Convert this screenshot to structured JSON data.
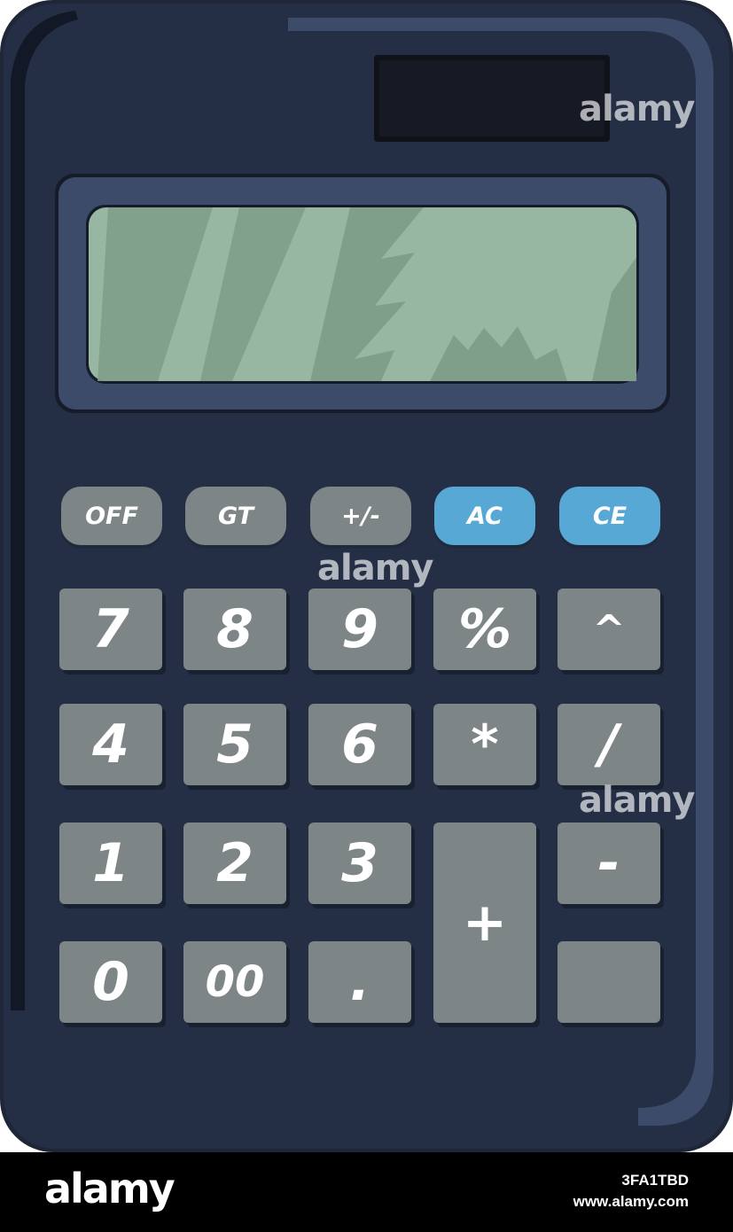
{
  "function_keys": [
    {
      "label": "OFF",
      "color": "#7e8587"
    },
    {
      "label": "GT",
      "color": "#7e8587"
    },
    {
      "label": "+/-",
      "color": "#7e8587"
    },
    {
      "label": "AC",
      "color": "#58a8d6"
    },
    {
      "label": "CE",
      "color": "#58a8d6"
    }
  ],
  "keys": {
    "seven": "7",
    "eight": "8",
    "nine": "9",
    "percent": "%",
    "power": "^",
    "four": "4",
    "five": "5",
    "six": "6",
    "multiply": "*",
    "divide": "/",
    "one": "1",
    "two": "2",
    "three": "3",
    "plus": "+",
    "minus": "-",
    "zero": "0",
    "double_zero": "00",
    "decimal": ".",
    "equals": ""
  },
  "watermark": {
    "brand": "alamy",
    "image_id": "3FA1TBD",
    "url": "www.alamy.com"
  },
  "colors": {
    "body": "#242e45",
    "rim": "#3d4b6a",
    "screen": "#8aab98",
    "solar_panel": "#161a24"
  }
}
